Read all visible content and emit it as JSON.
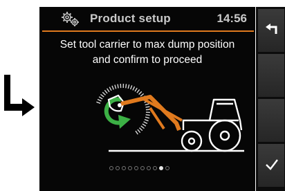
{
  "header": {
    "title": "Product setup",
    "time": "14:56",
    "icon": "gear-settings-icon"
  },
  "instruction": {
    "line1": "Set tool carrier to max dump position",
    "line2": "and confirm to proceed"
  },
  "illustration": {
    "description_icon": "tractor-loader-dump-icon",
    "rotation_color": "#3cb045",
    "arm_color": "#e07a1e"
  },
  "pager": {
    "total": 10,
    "active_index": 8
  },
  "softkeys": [
    {
      "name": "back",
      "icon": "return-arrow-icon"
    },
    {
      "name": "blank-2",
      "icon": ""
    },
    {
      "name": "blank-3",
      "icon": ""
    },
    {
      "name": "confirm",
      "icon": "checkmark-icon"
    }
  ],
  "colors": {
    "accent": "#e07a1e",
    "screen_bg": "#060606",
    "title_text": "#c9c9c9"
  }
}
